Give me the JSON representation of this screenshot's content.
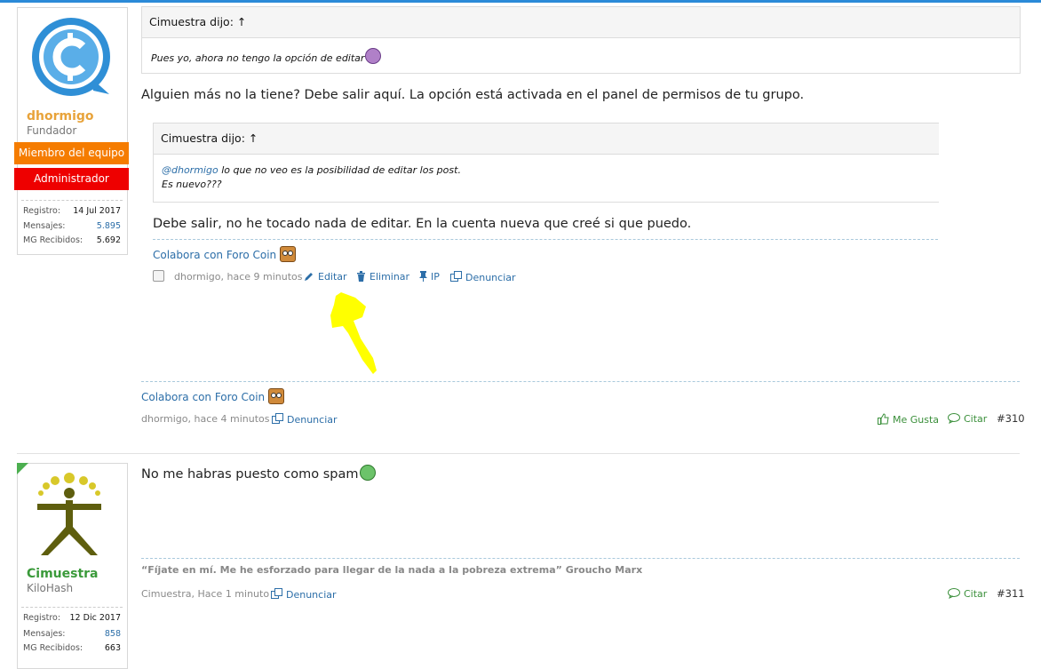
{
  "post1": {
    "user": {
      "name": "dhormigo",
      "title": "Fundador",
      "banner_team": "Miembro del equipo",
      "banner_admin": "Administrador",
      "stats": [
        {
          "label": "Registro:",
          "value": "14 Jul 2017"
        },
        {
          "label": "Mensajes:",
          "value": "5.895"
        },
        {
          "label": "MG Recibidos:",
          "value": "5.692"
        }
      ]
    },
    "quote1": {
      "header": "Cimuestra dijo: ↑",
      "body": "Pues yo, ahora no tengo la opción de editar"
    },
    "message": "Alguien más no la tiene? Debe salir aquí. La opción está activada en el panel de permisos de tu grupo.",
    "embed": {
      "quote_header": "Cimuestra dijo: ↑",
      "quote_mention": "@dhormigo",
      "quote_line1_rest": " lo que no veo es la posibilidad de editar los post.",
      "quote_line2": "Es nuevo???",
      "message": "Debe salir, no he tocado nada de editar. En la cuenta nueva que creé si que puedo.",
      "signature": "Colabora con Foro Coin",
      "meta": "dhormigo, hace 9 minutos",
      "actions": {
        "edit": "Editar",
        "delete": "Eliminar",
        "ip": "IP",
        "report": "Denunciar"
      }
    },
    "signature": "Colabora con Foro Coin",
    "meta": "dhormigo, hace 4 minutos",
    "report": "Denunciar",
    "like": "Me Gusta",
    "cite": "Citar",
    "number": "#310"
  },
  "post2": {
    "user": {
      "name": "Cimuestra",
      "title": "KiloHash",
      "stats": [
        {
          "label": "Registro:",
          "value": "12 Dic 2017"
        },
        {
          "label": "Mensajes:",
          "value": "858"
        },
        {
          "label": "MG Recibidos:",
          "value": "663"
        }
      ]
    },
    "message": "No me habras puesto como spam",
    "signature": "“Fíjate en mí. Me he esforzado para llegar de la nada a la pobreza extrema” Groucho Marx",
    "meta": "Cimuestra, Hace 1 minuto",
    "report": "Denunciar",
    "cite": "Citar",
    "number": "#311"
  },
  "colors": {
    "accent": "#2b8ad8",
    "link": "#2c6ea8",
    "team_banner": "#f57c00",
    "admin_banner": "#ee0000",
    "username_orange": "#e8a33a",
    "username_green": "#3a9a3a",
    "highlight_arrow": "#ffff00"
  },
  "icons": [
    "pencil-icon",
    "trash-icon",
    "pin-icon",
    "copy-icon",
    "thumbs-up-icon",
    "chat-icon",
    "checkbox"
  ]
}
